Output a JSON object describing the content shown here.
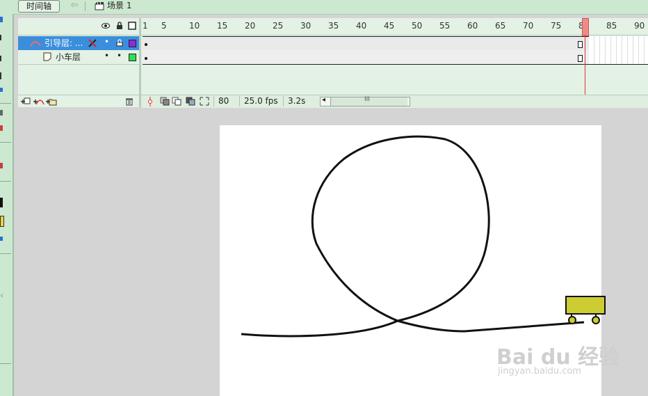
{
  "timeline": {
    "button_label": "时间轴",
    "back_arrow": "⇦",
    "scene_label": "场景 1"
  },
  "layers": [
    {
      "name": "引导层: ...",
      "selected": true,
      "color": "#8a2be2",
      "type": "guide"
    },
    {
      "name": "小车层",
      "selected": false,
      "color": "#33dd55",
      "type": "normal"
    }
  ],
  "ruler": {
    "ticks": [
      "1",
      "5",
      "10",
      "15",
      "20",
      "25",
      "30",
      "35",
      "40",
      "45",
      "50",
      "55",
      "60",
      "65",
      "70",
      "75",
      "80",
      "85",
      "90"
    ]
  },
  "status": {
    "current_frame": "80",
    "frame_rate": "25.0 fps",
    "elapsed": "3.2s",
    "scroll_grip": "III"
  },
  "colors": {
    "panel": "#e3f2e4",
    "selection": "#3b8edc",
    "playhead": "#f08a8a",
    "cart_body": "#cccc33"
  },
  "watermark": {
    "brand": "Bai  du 经验",
    "url": "jingyan.baidu.com"
  }
}
